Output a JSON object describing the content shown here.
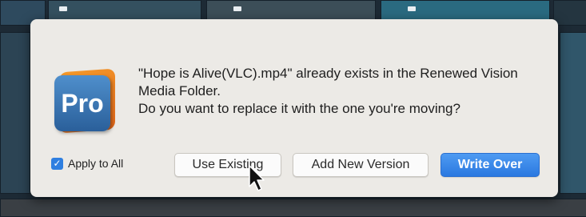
{
  "dialog": {
    "app_icon_text": "Pro",
    "message_line1": "\"Hope is Alive(VLC).mp4\" already exists in the Renewed Vision",
    "message_line2": "Media Folder.",
    "message_line3": "Do you want to replace it with the one you're moving?",
    "apply_to_all_label": "Apply to All",
    "apply_to_all_checked": true,
    "buttons": {
      "use_existing": "Use Existing",
      "add_new_version": "Add New Version",
      "write_over": "Write Over"
    }
  },
  "colors": {
    "accent": "#2a78e0",
    "dialog_bg": "#eceae6",
    "icon_orange": "#e0661a",
    "icon_blue": "#3a76b8"
  },
  "icons": {
    "app": "propresenter-app-icon",
    "checkbox": "checkmark-icon",
    "cursor": "mouse-pointer-icon"
  }
}
